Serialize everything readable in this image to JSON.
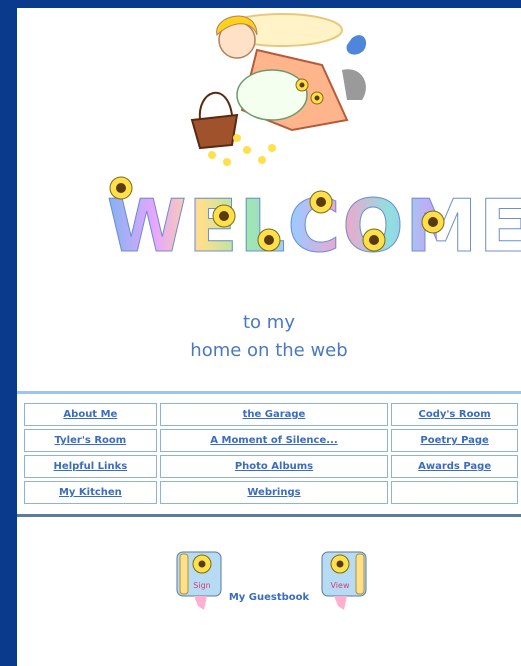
{
  "header": {
    "welcome": "WELCOME",
    "line1": "to my",
    "line2": "home on the web"
  },
  "nav": {
    "rows": [
      [
        "About Me",
        "the Garage",
        "Cody's Room"
      ],
      [
        "Tyler's Room",
        "A Moment of Silence...",
        "Poetry Page"
      ],
      [
        "Helpful Links",
        "Photo Albums",
        "Awards Page"
      ],
      [
        "My Kitchen",
        "Webrings",
        ""
      ]
    ]
  },
  "guestbook": {
    "sign_text": "Sign",
    "view_text": "View",
    "label": "My Guestbook"
  },
  "colors": {
    "background": "#0a3a8c",
    "link": "#3a6cc0",
    "subtitle": "#4a78c2"
  }
}
